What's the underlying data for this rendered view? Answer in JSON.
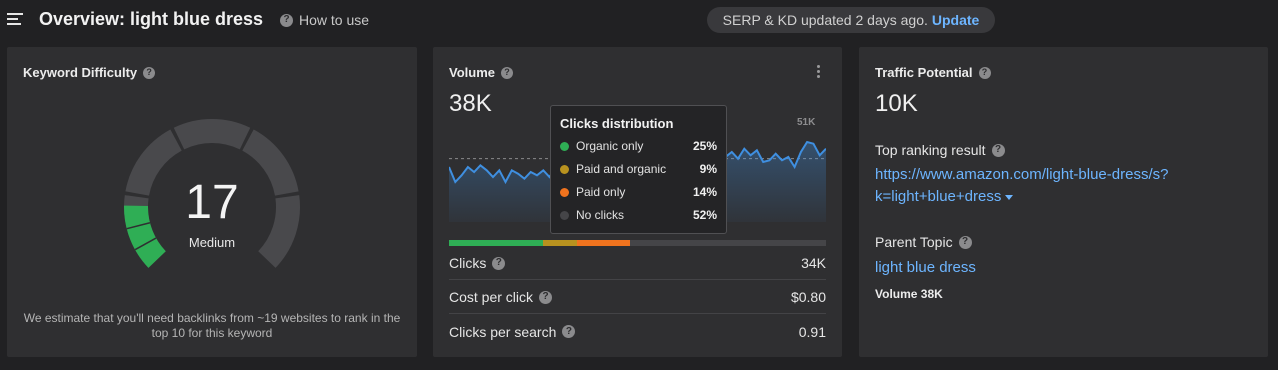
{
  "header": {
    "title": "Overview: light blue dress",
    "how_to_use": "How to use",
    "serp_status": "SERP & KD updated 2 days ago.",
    "update_label": "Update"
  },
  "keyword_difficulty": {
    "title": "Keyword Difficulty",
    "value": "17",
    "label": "Medium",
    "note": "We estimate that you'll need backlinks from ~19 websites to rank in the top 10 for this keyword",
    "gauge": {
      "filled_segments": 1,
      "total_segments": 5,
      "fill_fraction": 0.17,
      "track_color": "#49494c",
      "fill_color": "#2fae55"
    }
  },
  "volume": {
    "title": "Volume",
    "value": "38K",
    "chart_max_label": "51K",
    "chart_data": {
      "type": "area",
      "ylim": [
        0,
        51000
      ],
      "values": [
        33000,
        24000,
        28000,
        33000,
        30000,
        34000,
        31000,
        27000,
        31000,
        24000,
        31000,
        29000,
        26000,
        30000,
        28000,
        31000,
        27000,
        33000,
        30000,
        35000,
        28000,
        25000,
        27000,
        24000,
        30000,
        28000,
        26000,
        32000,
        29000,
        25000,
        24000,
        27000,
        23000,
        25000,
        27000,
        29000,
        34000,
        40000,
        38000,
        33000,
        36000,
        38000,
        30000,
        34000,
        39000,
        42000,
        38000,
        44000,
        40000,
        43000,
        36000,
        37000,
        41000,
        37000,
        39000,
        33000,
        42000,
        48000,
        47000,
        40000,
        44000
      ],
      "avg_line": 38000,
      "line_color": "#3f8fe0"
    },
    "distribution_bar": [
      {
        "name": "Organic only",
        "value": 25,
        "color": "#2fae55"
      },
      {
        "name": "Paid and organic",
        "value": 9,
        "color": "#b8921f"
      },
      {
        "name": "Paid only",
        "value": 14,
        "color": "#f0731e"
      },
      {
        "name": "No clicks",
        "value": 52,
        "color": "#454548"
      }
    ],
    "metrics": [
      {
        "label": "Clicks",
        "value": "34K"
      },
      {
        "label": "Cost per click",
        "value": "$0.80"
      },
      {
        "label": "Clicks per search",
        "value": "0.91"
      }
    ]
  },
  "clicks_tooltip": {
    "title": "Clicks distribution",
    "rows": [
      {
        "label": "Organic only",
        "value": "25%",
        "color": "#2fae55"
      },
      {
        "label": "Paid and organic",
        "value": "9%",
        "color": "#b8921f"
      },
      {
        "label": "Paid only",
        "value": "14%",
        "color": "#f0731e"
      },
      {
        "label": "No clicks",
        "value": "52%",
        "color": "#454548"
      }
    ]
  },
  "traffic_potential": {
    "title": "Traffic Potential",
    "value": "10K",
    "top_ranking_label": "Top ranking result",
    "top_ranking_url": "https://www.amazon.com/light-blue-dress/s?k=light+blue+dress",
    "parent_topic_label": "Parent Topic",
    "parent_topic": "light blue dress",
    "parent_volume": "Volume 38K"
  }
}
